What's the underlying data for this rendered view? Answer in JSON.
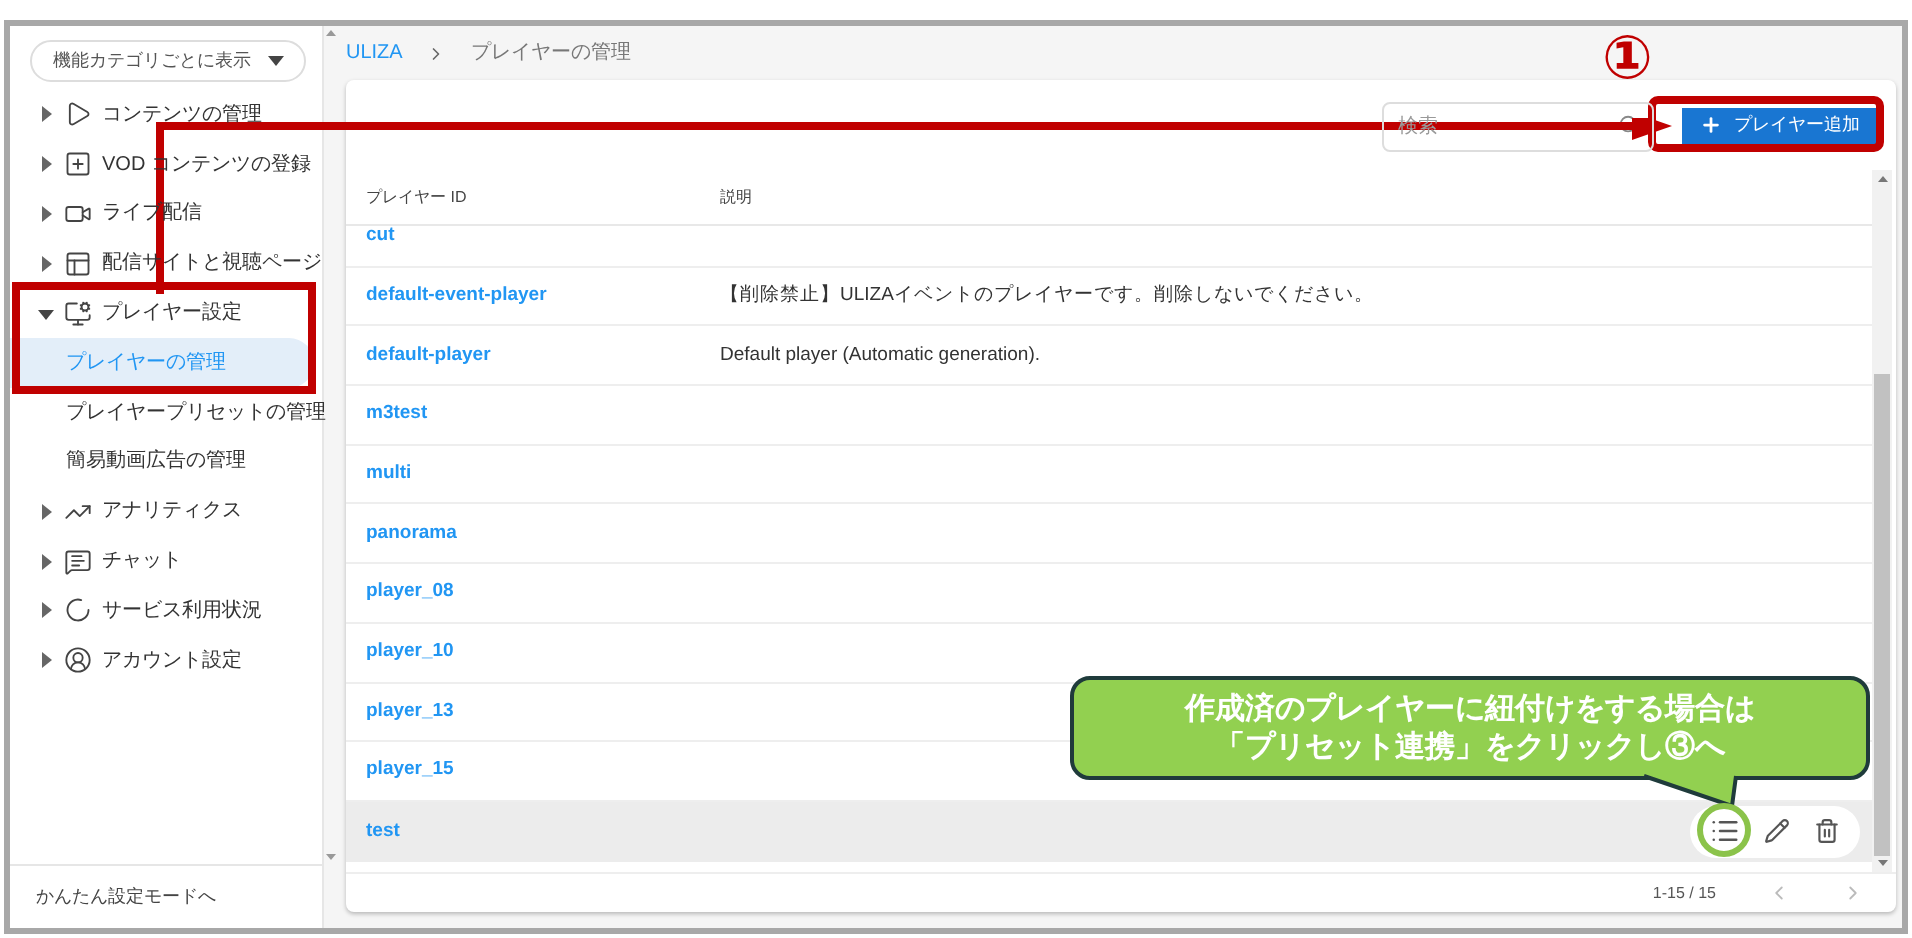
{
  "sidebar": {
    "view_selector": "機能カテゴリごとに表示",
    "items": [
      {
        "label": "コンテンツの管理",
        "expanded": false
      },
      {
        "label": "VOD コンテンツの登録",
        "expanded": false
      },
      {
        "label": "ライブ配信",
        "expanded": false
      },
      {
        "label": "配信サイトと視聴ページ",
        "expanded": false
      },
      {
        "label": "プレイヤー設定",
        "expanded": true,
        "children": [
          {
            "label": "プレイヤーの管理",
            "selected": true
          },
          {
            "label": "プレイヤープリセットの管理",
            "selected": false
          },
          {
            "label": "簡易動画広告の管理",
            "selected": false
          }
        ]
      },
      {
        "label": "アナリティクス",
        "expanded": false
      },
      {
        "label": "チャット",
        "expanded": false
      },
      {
        "label": "サービス利用状況",
        "expanded": false
      },
      {
        "label": "アカウント設定",
        "expanded": false
      }
    ],
    "footer_link": "かんたん設定モードへ"
  },
  "breadcrumb": [
    "ULIZA",
    "プレイヤーの管理"
  ],
  "toolbar": {
    "search": {
      "placeholder": "検索"
    },
    "add_button": "プレイヤー追加"
  },
  "table": {
    "columns": [
      "プレイヤー ID",
      "説明"
    ],
    "rows": [
      {
        "id": "cut",
        "description": "",
        "selected": false
      },
      {
        "id": "default-event-player",
        "description": "【削除禁止】ULIZAイベントのプレイヤーです。削除しないでください。",
        "selected": false
      },
      {
        "id": "default-player",
        "description": "Default player (Automatic generation).",
        "selected": false
      },
      {
        "id": "m3test",
        "description": "",
        "selected": false
      },
      {
        "id": "multi",
        "description": "",
        "selected": false
      },
      {
        "id": "panorama",
        "description": "",
        "selected": false
      },
      {
        "id": "player_08",
        "description": "",
        "selected": false
      },
      {
        "id": "player_10",
        "description": "",
        "selected": false
      },
      {
        "id": "player_13",
        "description": "",
        "selected": false
      },
      {
        "id": "player_15",
        "description": "",
        "selected": false
      },
      {
        "id": "test",
        "description": "",
        "selected": true
      }
    ],
    "pagination": "1-15 / 15"
  },
  "annotations": {
    "step_label": "①",
    "callout": [
      "作成済のプレイヤーに紐付けをする場合は",
      "「プリセット連携」をクリックし③へ"
    ]
  }
}
